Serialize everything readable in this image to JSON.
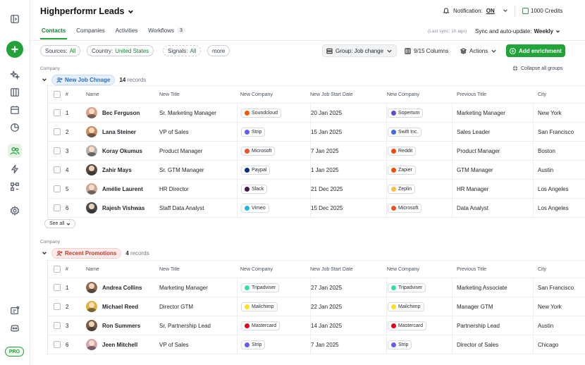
{
  "header": {
    "title": "Highperformr Leads",
    "notification_label": "Notification:",
    "notification_value": "ON",
    "credits": "1000 Credits"
  },
  "tabs": [
    {
      "label": "Contacts",
      "active": true
    },
    {
      "label": "Companies"
    },
    {
      "label": "Activities"
    },
    {
      "label": "Workflows",
      "count": "3"
    }
  ],
  "sync": {
    "last_sync": "(Last sync: 1h ago)",
    "label": "Sync and auto-update:",
    "value": "Weekly"
  },
  "filters": {
    "sources_label": "Sources:",
    "sources_value": "All",
    "country_label": "Country:",
    "country_value": "United States",
    "signals_label": "Signals:",
    "signals_value": "All",
    "more": "more"
  },
  "toolbar": {
    "group_by": "Group: Job change",
    "columns": "9/15 Columns",
    "actions": "Actions",
    "add_enrichment": "Add enrichment",
    "collapse_all": "Collapse all groups"
  },
  "columns": {
    "num": "#",
    "name": "Name",
    "new_title": "New Title",
    "new_company": "New Company",
    "start_date": "New Job Start Date",
    "new_company2": "New Company",
    "prev_title": "Previous Title",
    "city": "City"
  },
  "groups": [
    {
      "label": "Company",
      "name": "New Job Chnage",
      "count": "14",
      "records": "records",
      "see_all": "See all",
      "rows": [
        {
          "num": "1",
          "name": "Bec Ferguson",
          "title": "Sr. Marketing Manager",
          "company": "Soundcloud",
          "company_color": "#ff5500",
          "date": "20 Jan 2025",
          "company2": "Sopertum",
          "company2_color": "#5b4bd8",
          "prev_title": "Marketing Manager",
          "city": "New York",
          "avatar": "#d9a08a"
        },
        {
          "num": "2",
          "name": "Lana Steiner",
          "title": "VP of Sales",
          "company": "Strip",
          "company_color": "#635bff",
          "date": "15 Jan 2025",
          "company2": "Swift Inc.",
          "company2_color": "#4169e1",
          "prev_title": "Sales Leader",
          "city": "San Francisco",
          "avatar": "#c98b5e"
        },
        {
          "num": "3",
          "name": "Koray Okumus",
          "title": "Product Manager",
          "company": "Microsoft",
          "company_color": "#f25022",
          "date": "7 Jan 2025",
          "company2": "Reddit",
          "company2_color": "#ff4500",
          "prev_title": "Product Manager",
          "city": "Boston",
          "avatar": "#b7b1ad"
        },
        {
          "num": "4",
          "name": "Zahir Mays",
          "title": "Sr. GTM Manager",
          "company": "Paypal",
          "company_color": "#003087",
          "date": "1 Jan 2025",
          "company2": "Zapier",
          "company2_color": "#ff4a00",
          "prev_title": "GTM Manager",
          "city": "Austin",
          "avatar": "#5b4a40"
        },
        {
          "num": "5",
          "name": "Amélie Laurent",
          "title": "HR Director",
          "company": "Slack",
          "company_color": "#4a154b",
          "date": "21 Dec 2025",
          "company2": "Zeplin",
          "company2_color": "#fdbd39",
          "prev_title": "HR Manager",
          "city": "Los Angeles",
          "avatar": "#c7a99a"
        },
        {
          "num": "6",
          "name": "Rajesh Vishwas",
          "title": "Staff Data Analyst",
          "company": "Vimeo",
          "company_color": "#1ab7ea",
          "date": "15 Dec 2025",
          "company2": "Microsoft",
          "company2_color": "#f25022",
          "prev_title": "Data Analyst",
          "city": "Los Angeles",
          "avatar": "#4a4a4a"
        }
      ]
    },
    {
      "label": "Company",
      "name": "Recent Promotions",
      "count": "4",
      "records": "records",
      "rows": [
        {
          "num": "1",
          "name": "Andrea Collins",
          "title": "Marketing Manager",
          "company": "Tripadviser",
          "company_color": "#34e0a1",
          "date": "27 Jan 2025",
          "company2": "Tripadviser",
          "company2_color": "#34e0a1",
          "prev_title": "Marketing Associate",
          "city": "San Francisco",
          "avatar": "#8a6a52"
        },
        {
          "num": "2",
          "name": "Michael Reed",
          "title": "Director GTM",
          "company": "Mailchimp",
          "company_color": "#ffe01b",
          "date": "22 Jan 2025",
          "company2": "Mailchimp",
          "company2_color": "#ffe01b",
          "prev_title": "Manager GTM",
          "city": "New York",
          "avatar": "#e0b03a"
        },
        {
          "num": "3",
          "name": "Ron Summers",
          "title": "Sr. Partnership Lead",
          "company": "Mastercard",
          "company_color": "#eb001b",
          "date": "14 Jan 2025",
          "company2": "Mastercard",
          "company2_color": "#eb001b",
          "prev_title": "Partnership Lead",
          "city": "Austin",
          "avatar": "#7a5a48"
        },
        {
          "num": "6",
          "name": "Jeen Mitchell",
          "title": "VP of Sales",
          "company": "Strip",
          "company_color": "#635bff",
          "date": "7 Jan 2025",
          "company2": "Strip",
          "company2_color": "#635bff",
          "prev_title": "Director of Sales",
          "city": "Chicago",
          "avatar": "#d4a3b0"
        }
      ]
    }
  ],
  "rail": {
    "pro": "PRO"
  }
}
